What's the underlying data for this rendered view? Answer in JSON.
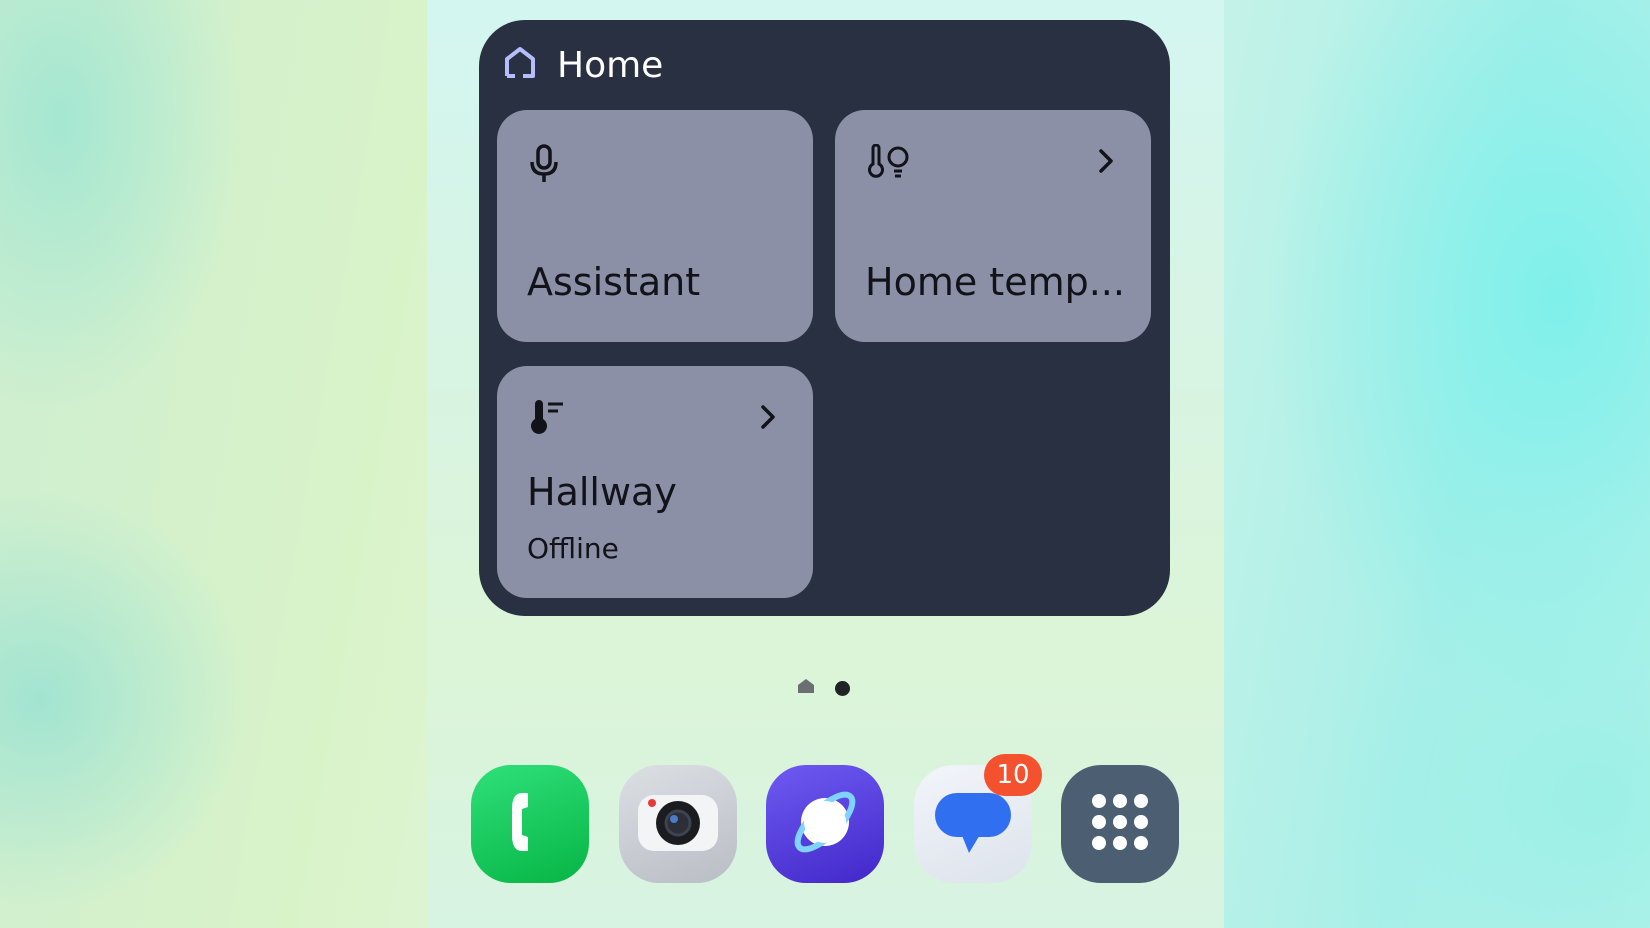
{
  "widget": {
    "title": "Home",
    "tiles": [
      {
        "label": "Assistant",
        "icon": "microphone-icon"
      },
      {
        "label": "Home temp...",
        "icon": "thermometer-bulb-icon",
        "chevron": "chevron-right-icon"
      },
      {
        "label": "Hallway",
        "status": "Offline",
        "icon": "thermometer-icon",
        "chevron": "chevron-right-icon"
      }
    ]
  },
  "page_indicators": {
    "count": 2,
    "current": 2
  },
  "dock": {
    "apps": [
      {
        "app": "phone",
        "icon": "phone-icon"
      },
      {
        "app": "camera",
        "icon": "camera-icon"
      },
      {
        "app": "internet",
        "icon": "planet-icon"
      },
      {
        "app": "messages",
        "icon": "chat-bubble-icon",
        "badge": "10"
      },
      {
        "app": "apps",
        "icon": "grid-icon"
      }
    ]
  },
  "colors": {
    "widget_bg": "#283041",
    "tile_bg": "#8b90a7",
    "badge": "#f4512f",
    "phone_green": "#07b545",
    "internet_purple": "#4227c9"
  }
}
